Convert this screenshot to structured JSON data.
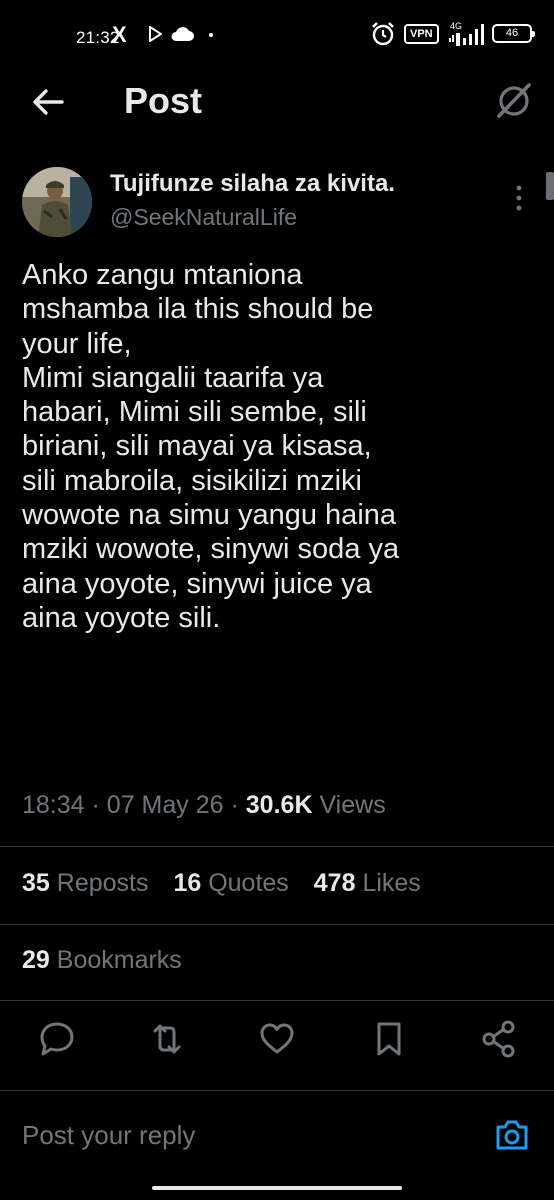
{
  "status_bar": {
    "time": "21:32",
    "x_logo": "X",
    "vpn": "VPN",
    "network": "4G",
    "battery": "46"
  },
  "header": {
    "title": "Post"
  },
  "author": {
    "name": "Tujifunze silaha za kivita.",
    "handle": "@SeekNaturalLife"
  },
  "post": {
    "text": "Anko zangu mtaniona\nmshamba ila this should be\nyour life,\nMimi siangalii taarifa ya\nhabari, Mimi sili sembe, sili\nbiriani, sili mayai ya kisasa,\nsili mabroila, sisikilizi mziki\nwowote na simu yangu haina\nmziki wowote, sinywi soda ya\naina yoyote, sinywi juice ya\naina yoyote sili.",
    "time": "18:34",
    "date": "07 May 26",
    "views_count": "30.6K",
    "views_label": "Views",
    "sep": "·"
  },
  "stats": {
    "reposts_count": "35",
    "reposts_label": "Reposts",
    "quotes_count": "16",
    "quotes_label": "Quotes",
    "likes_count": "478",
    "likes_label": "Likes",
    "bookmarks_count": "29",
    "bookmarks_label": "Bookmarks"
  },
  "actions": {
    "icons": [
      "reply-icon",
      "repost-icon",
      "like-icon",
      "bookmark-icon",
      "share-icon"
    ]
  },
  "reply": {
    "placeholder": "Post your reply"
  },
  "colors": {
    "background": "#000000",
    "text": "#e7e9ea",
    "muted": "#71767b",
    "accent": "#1d9bf0",
    "divider": "#2f3336"
  }
}
